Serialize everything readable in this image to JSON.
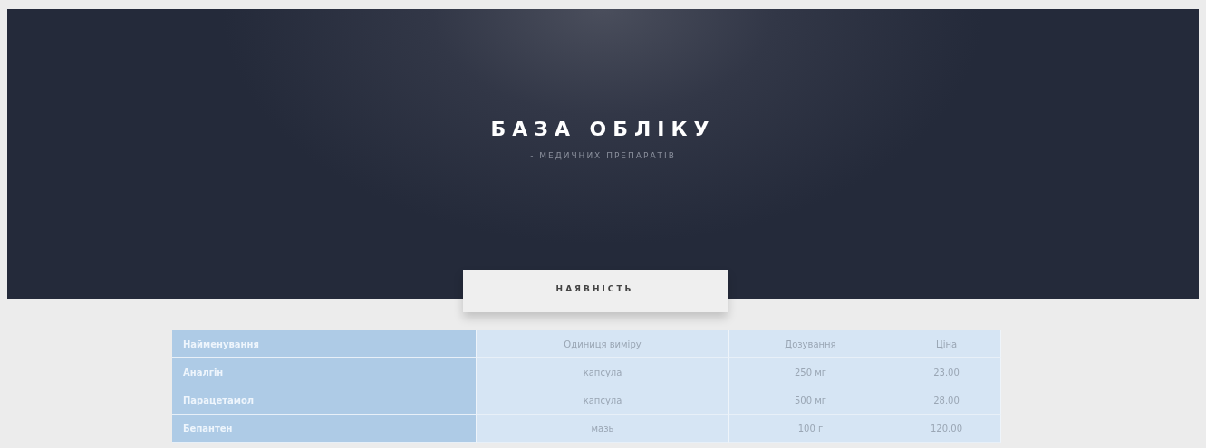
{
  "header": {
    "title": "БАЗА ОБЛІКУ",
    "subtitle": "- МЕДИЧНИХ ПРЕПАРАТІВ"
  },
  "tab": {
    "label": "НАЯВНІСТЬ"
  },
  "table": {
    "columns": [
      "Найменування",
      "Одиниця виміру",
      "Дозування",
      "Ціна"
    ],
    "rows": [
      [
        "Аналгін",
        "капсула",
        "250 мг",
        "23.00"
      ],
      [
        "Парацетамол",
        "капсула",
        "500 мг",
        "28.00"
      ],
      [
        "Бепантен",
        "мазь",
        "100 г",
        "120.00"
      ]
    ]
  }
}
